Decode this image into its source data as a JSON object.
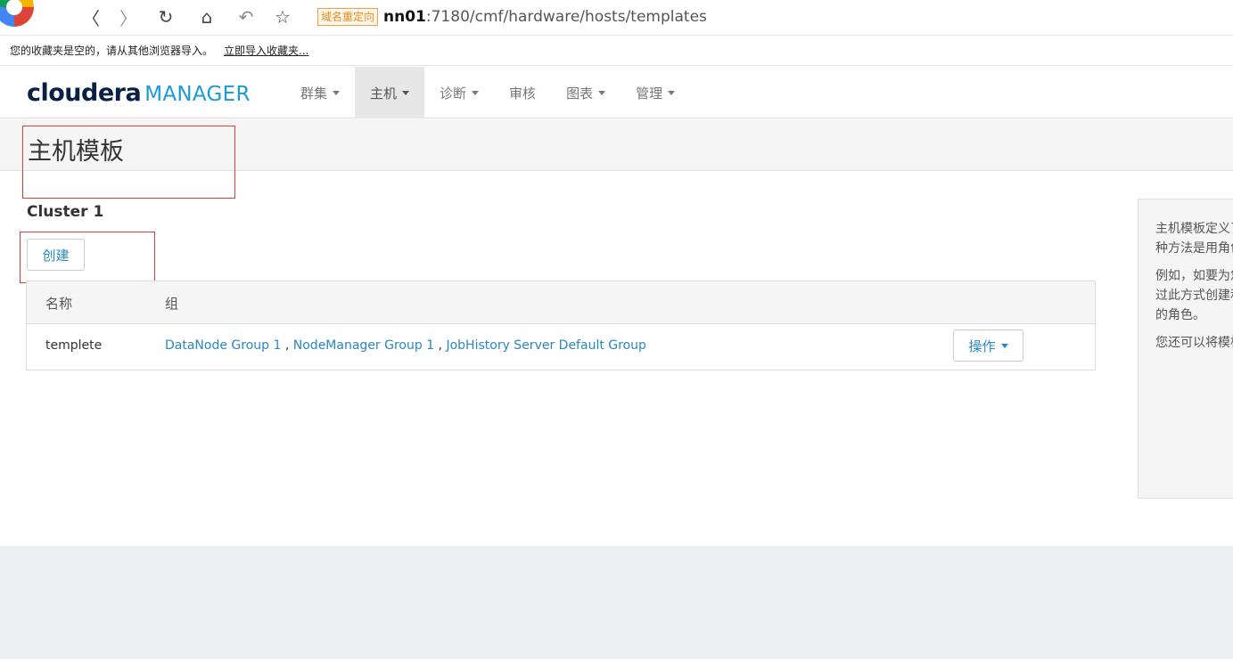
{
  "browser": {
    "redirect_tag": "域名重定向",
    "url_host": "nn01",
    "url_path": ":7180/cmf/hardware/hosts/templates",
    "back_glyph": "〈",
    "forward_glyph": "〉",
    "reload_glyph": "↻",
    "home_glyph": "⌂",
    "undo_glyph": "↶",
    "star_glyph": "☆"
  },
  "bookmarks": {
    "empty_text": "您的收藏夹是空的，请从其他浏览器导入。",
    "import_link": "立即导入收藏夹..."
  },
  "nav": {
    "logo_primary": "cloudera",
    "logo_secondary": "MANAGER",
    "items": [
      {
        "label": "群集",
        "has_caret": true
      },
      {
        "label": "主机",
        "has_caret": true,
        "active": true
      },
      {
        "label": "诊断",
        "has_caret": true
      },
      {
        "label": "审核",
        "has_caret": false
      },
      {
        "label": "图表",
        "has_caret": true
      },
      {
        "label": "管理",
        "has_caret": true
      }
    ]
  },
  "page": {
    "title": "主机模板",
    "cluster_name": "Cluster 1",
    "create_label": "创建"
  },
  "table": {
    "headers": {
      "name": "名称",
      "group": "组"
    },
    "rows": [
      {
        "name": "templete",
        "groups": [
          "DataNode Group 1",
          "NodeManager Group 1",
          "JobHistory Server Default Group"
        ],
        "separator": " , ",
        "action_label": "操作"
      }
    ]
  },
  "help": {
    "paragraphs": [
      "主机模板定义了一组角色组。使用主机模板的一种方法是用角色",
      "例如，如要为您的群集添加更多的主机，可以通过此方式创建和应用主机模板，然后可以为所有的角色。",
      "您还可以将模板应用到主机。包含已有的角色。"
    ]
  },
  "colors": {
    "accent": "#2a87c4",
    "logo_dark": "#0a1f44",
    "logo_blue": "#1a9ad6",
    "annotation_red": "#e23b3b"
  }
}
